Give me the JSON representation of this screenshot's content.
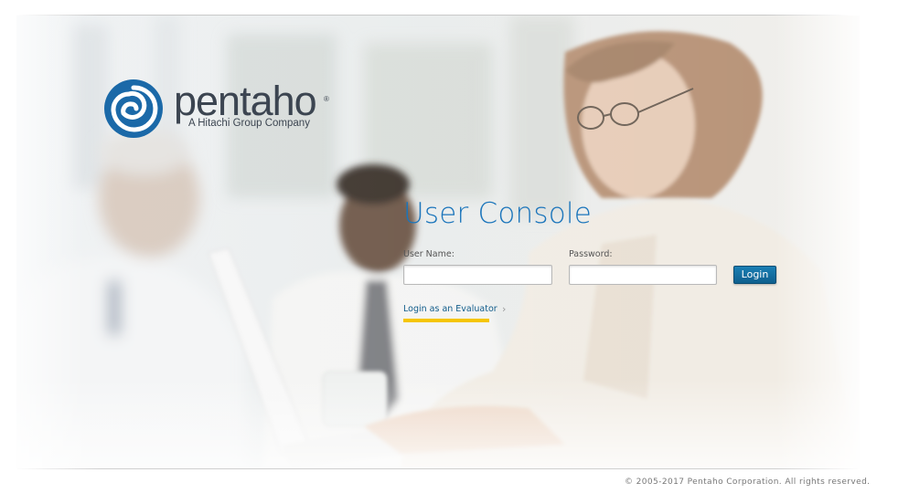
{
  "logo": {
    "wordmark": "pentaho",
    "registered": "®",
    "tagline": "A Hitachi Group Company"
  },
  "login_form": {
    "title": "User Console",
    "username_label": "User Name:",
    "username_value": "",
    "password_label": "Password:",
    "password_value": "",
    "login_button": "Login",
    "evaluator_link": "Login as an Evaluator",
    "evaluator_chevron": "›"
  },
  "footer": {
    "copyright": "© 2005-2017 Pentaho Corporation. All rights reserved."
  },
  "colors": {
    "title_blue": "#1b75bb",
    "button_blue": "#0e5f8e",
    "link_blue": "#0f5b8a",
    "evaluator_underline": "#f5c500",
    "logo_text": "#3c4551",
    "logo_mark": "#1b69a8"
  }
}
